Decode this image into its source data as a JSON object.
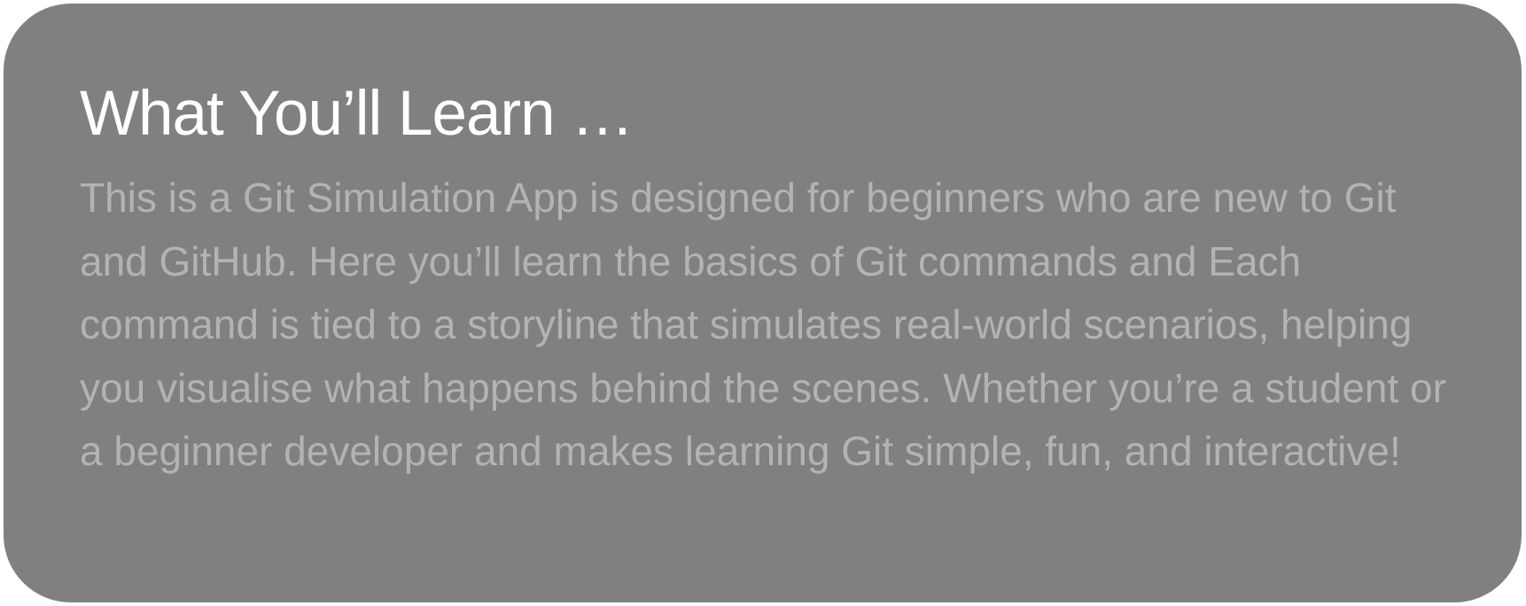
{
  "info_card": {
    "title": "What You’ll Learn …",
    "description": "This is a Git Simulation App is designed for beginners who are new to Git and GitHub. Here you’ll learn the basics of Git commands and Each command is tied to a storyline that simulates real-world scenarios, helping you visualise what happens behind the scenes. Whether you’re a student or a beginner developer and makes learning Git simple, fun, and interactive!"
  },
  "colors": {
    "page_background": "#ffffff",
    "card_background": "#808080",
    "title_text": "#ffffff",
    "body_text": "#b3b3b3"
  }
}
